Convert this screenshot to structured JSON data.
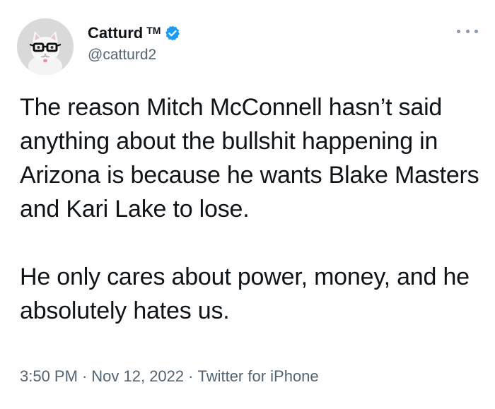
{
  "author": {
    "display_name": "Catturd",
    "tm": "TM",
    "handle": "@catturd2",
    "verified": true,
    "verified_icon": "verified-badge-icon",
    "avatar_icon": "cat-with-glasses-avatar"
  },
  "menu": {
    "icon": "more-options-icon"
  },
  "tweet": {
    "paragraphs": [
      "The reason Mitch McConnell hasn’t said anything about the bullshit happening in Arizona is because he wants Blake Masters and Kari Lake to lose.",
      "He only cares about power, money, and he absolutely hates us."
    ]
  },
  "meta": {
    "time": "3:50 PM",
    "separator": "·",
    "date": "Nov 12, 2022",
    "source": "Twitter for iPhone"
  },
  "colors": {
    "text": "#0f1419",
    "secondary": "#536471",
    "verified": "#1d9bf0"
  }
}
